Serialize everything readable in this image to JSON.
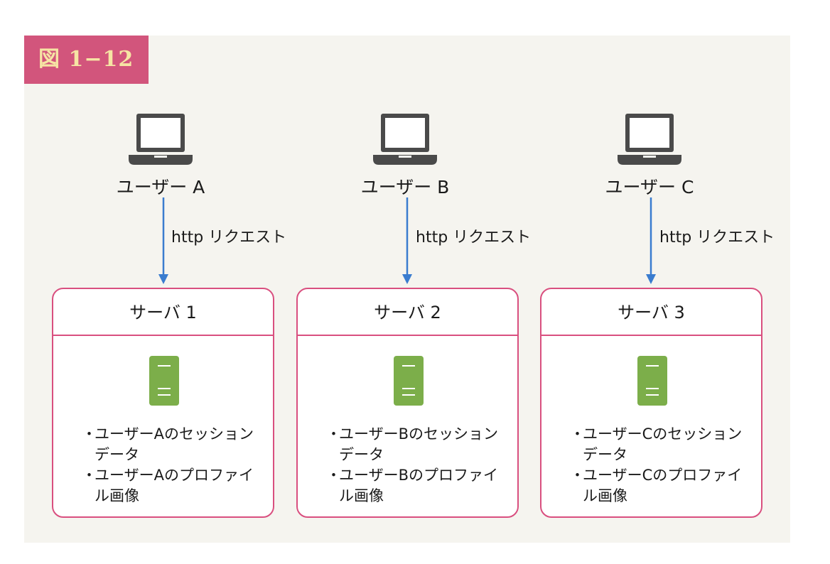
{
  "figure": {
    "label": "図 1−12"
  },
  "columns": [
    {
      "user": "ユーザー A",
      "request": "http リクエスト",
      "server": "サーバ 1",
      "notes": [
        "ユーザーAのセッションデータ",
        "ユーザーAのプロファイル画像"
      ]
    },
    {
      "user": "ユーザー B",
      "request": "http リクエスト",
      "server": "サーバ 2",
      "notes": [
        "ユーザーBのセッションデータ",
        "ユーザーBのプロファイル画像"
      ]
    },
    {
      "user": "ユーザー C",
      "request": "http リクエスト",
      "server": "サーバ 3",
      "notes": [
        "ユーザーCのセッションデータ",
        "ユーザーCのプロファイル画像"
      ]
    }
  ],
  "colors": {
    "label_bg": "#d2557c",
    "label_text": "#f6e4a4",
    "box_border": "#d94f7f",
    "arrow": "#3a7ccf",
    "server_icon": "#7cae4a",
    "laptop": "#4a4a4a",
    "panel_bg": "#f5f4ef"
  },
  "icons": {
    "client": "laptop-icon",
    "server": "server-icon",
    "request": "arrow-down-icon"
  }
}
